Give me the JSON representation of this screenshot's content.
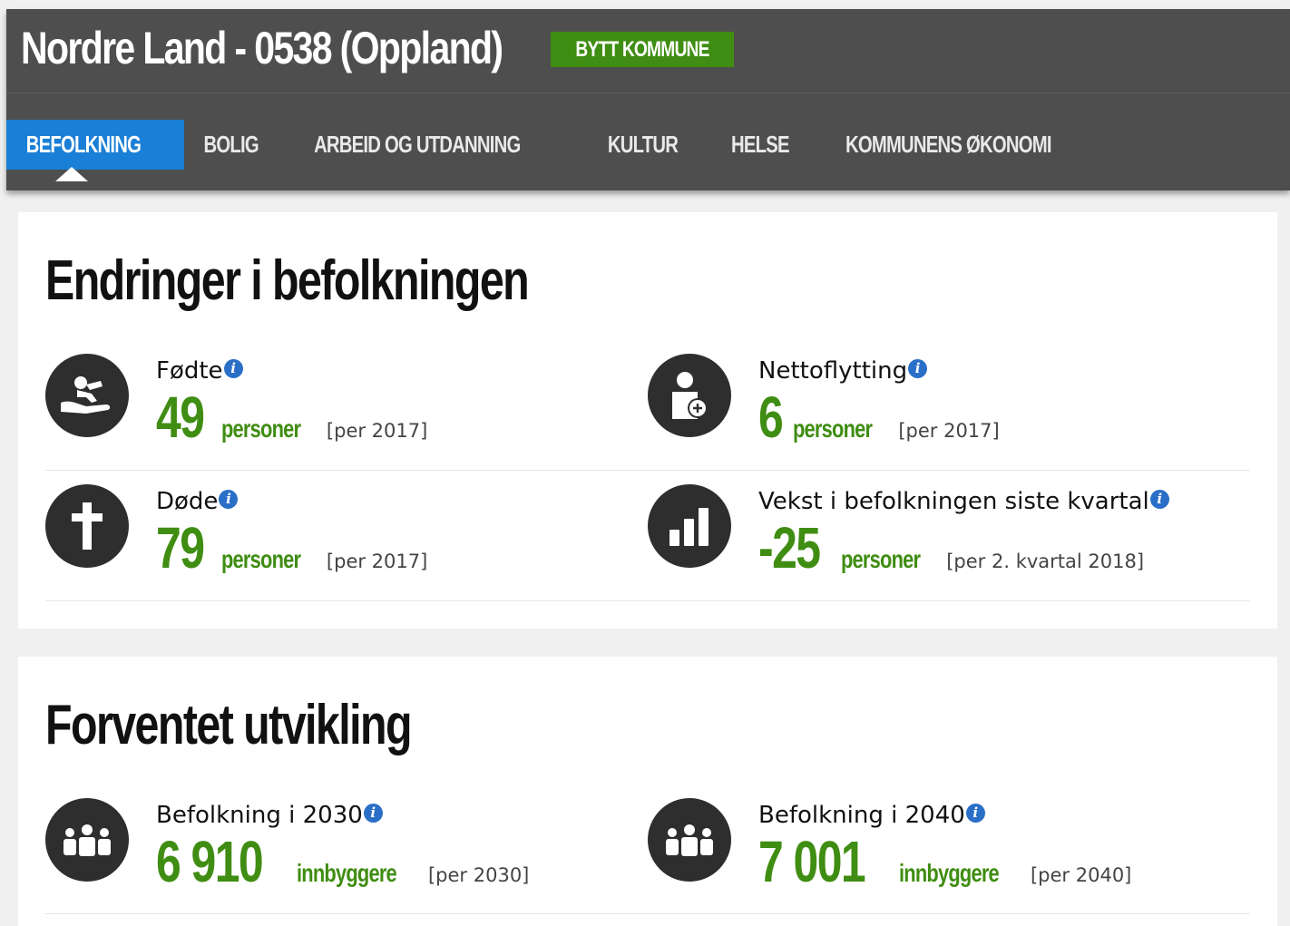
{
  "header": {
    "title": "Nordre Land - 0538 (Oppland)",
    "switch_button": "BYTT KOMMUNE"
  },
  "nav": {
    "items": [
      {
        "label": "BEFOLKNING",
        "active": true
      },
      {
        "label": "BOLIG"
      },
      {
        "label": "ARBEID OG UTDANNING"
      },
      {
        "label": "KULTUR"
      },
      {
        "label": "HELSE"
      },
      {
        "label": "KOMMUNENS ØKONOMI"
      }
    ]
  },
  "changes": {
    "title": "Endringer i befolkningen",
    "stats": [
      {
        "label": "Fødte",
        "value": "49",
        "unit": "personer",
        "period": "[per 2017]",
        "icon": "baby-in-hand-icon"
      },
      {
        "label": "Nettoflytting",
        "value": "6",
        "unit": "personer",
        "period": "[per 2017]",
        "icon": "person-add-icon"
      },
      {
        "label": "Døde",
        "value": "79",
        "unit": "personer",
        "period": "[per 2017]",
        "icon": "cross-icon"
      },
      {
        "label": "Vekst i befolkningen siste kvartal",
        "value": "-25",
        "unit": "personer",
        "period": "[per 2. kvartal 2018]",
        "icon": "bar-chart-icon"
      }
    ]
  },
  "forecast": {
    "title": "Forventet utvikling",
    "stats": [
      {
        "label": "Befolkning i 2030",
        "value": "6 910",
        "unit": "innbyggere",
        "period": "[per 2030]",
        "icon": "group-icon"
      },
      {
        "label": "Befolkning i 2040",
        "value": "7 001",
        "unit": "innbyggere",
        "period": "[per 2040]",
        "icon": "group-icon"
      }
    ]
  },
  "colors": {
    "header_bg": "#4e4e4e",
    "accent_green": "#3f8d12",
    "active_tab": "#1a7fd6",
    "info_blue": "#2a6fc7"
  }
}
